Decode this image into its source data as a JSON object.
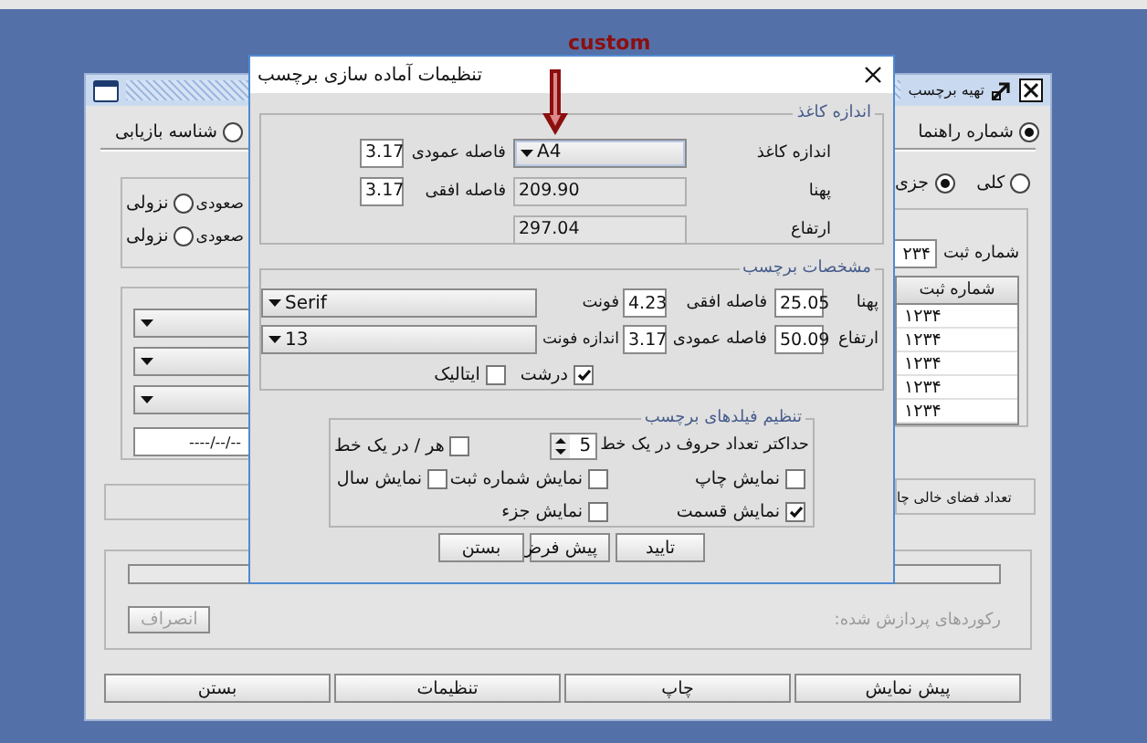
{
  "annotation": {
    "text": "custom"
  },
  "back_window": {
    "title": "تهیه برچسب",
    "mode_options": [
      {
        "label": "شماره راهنما",
        "selected": true
      },
      {
        "label": "شناسه بازیابی",
        "selected": false
      }
    ],
    "scope_options": [
      {
        "label": "کلی",
        "selected": false
      },
      {
        "label": "جزی",
        "selected": true
      }
    ],
    "sort_rows": [
      {
        "ascending_label": "صعودی",
        "descending": {
          "label": "نزولی",
          "selected": false
        }
      },
      {
        "ascending_label": "صعودی",
        "descending": {
          "label": "نزولی",
          "selected": false
        }
      }
    ],
    "date_field": {
      "value": "----/--/--"
    },
    "register_label": "شماره ثبت",
    "register_value": "۲۳۴",
    "table": {
      "columns": [
        "شماره ثبت"
      ],
      "rows": [
        "۱۲۳۴",
        "۱۲۳۴",
        "۱۲۳۴",
        "۱۲۳۴",
        "۱۲۳۴"
      ]
    },
    "empty_space_label": "تعداد فضای خالی چا",
    "progress": {
      "level": 0
    },
    "cancel_button": {
      "label": "انصراف",
      "disabled": true
    },
    "processed_label": "رکوردهای پردازش شده:",
    "buttons": [
      "پیش نمایش",
      "چاپ",
      "تنظیمات",
      "بستن"
    ]
  },
  "dialog": {
    "title": "تنظیمات آماده سازی برچسب",
    "paper": {
      "title": "اندازه کاغذ",
      "size_label": "اندازه کاغذ",
      "size_value": "A4",
      "width_label": "پهنا",
      "width_value": "209.90",
      "height_label": "ارتفاع",
      "height_value": "297.04",
      "vgap_label": "فاصله عمودی",
      "vgap_value": "3.17",
      "hgap_label": "فاصله افقی",
      "hgap_value": "3.17"
    },
    "label_spec": {
      "title": "مشخصات برچسب",
      "width_label": "پهنا",
      "width_value": "25.05",
      "height_label": "ارتفاع",
      "height_value": "50.09",
      "hgap_label": "فاصله افقی",
      "hgap_value": "4.23",
      "vgap_label": "فاصله عمودی",
      "vgap_value": "3.17",
      "font_label": "فونت",
      "font_value": "Serif",
      "font_size_label": "اندازه فونت",
      "font_size_value": "13",
      "styles": [
        {
          "label": "درشت",
          "checked": true
        },
        {
          "label": "ایتالیک",
          "checked": false
        }
      ]
    },
    "fields": {
      "title": "تنظیم فیلدهای برچسب",
      "max_chars_label": "حداکتر تعداد حروف در یک خط",
      "max_chars_value": "5",
      "per_line": {
        "label": "هر / در یک خط",
        "checked": false
      },
      "options": [
        {
          "label": "نمایش چاپ",
          "checked": false
        },
        {
          "label": "نمایش شماره ثبت",
          "checked": false
        },
        {
          "label": "نمایش سال",
          "checked": false
        },
        {
          "label": "نمایش قسمت",
          "checked": true
        },
        {
          "label": "نمایش جزء",
          "checked": false
        }
      ]
    },
    "buttons": [
      "تایید",
      "پیش فرض",
      "بستن"
    ]
  }
}
